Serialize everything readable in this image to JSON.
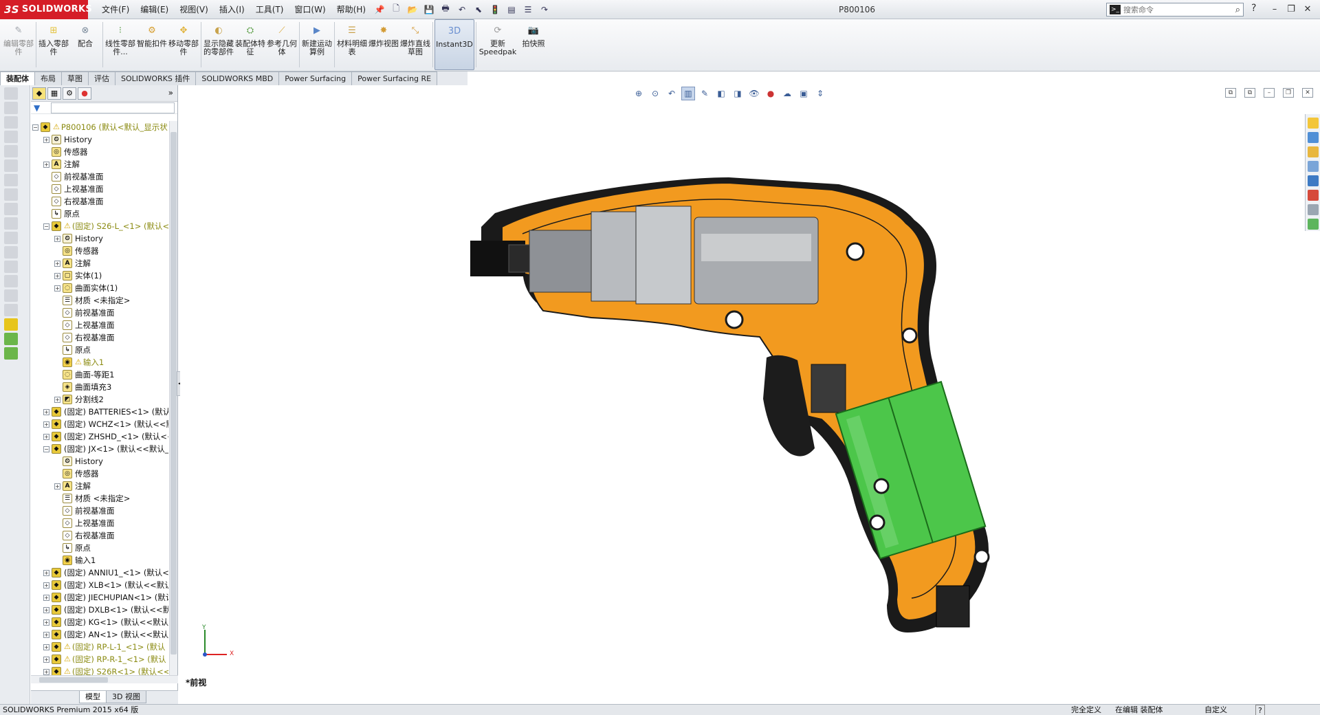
{
  "app": {
    "logo_text": "SOLIDWORKS",
    "document_title": "P800106"
  },
  "menu": [
    "文件(F)",
    "编辑(E)",
    "视图(V)",
    "插入(I)",
    "工具(T)",
    "窗口(W)",
    "帮助(H)"
  ],
  "search": {
    "placeholder": "搜索命令"
  },
  "commands": [
    {
      "label": "编辑零部件",
      "disabled": true
    },
    {
      "label": "插入零部件"
    },
    {
      "label": "配合"
    },
    {
      "label": "线性零部件..."
    },
    {
      "label": "智能扣件"
    },
    {
      "label": "移动零部件"
    },
    {
      "label": "显示隐藏的零部件"
    },
    {
      "label": "装配体特征"
    },
    {
      "label": "参考几何体"
    },
    {
      "label": "新建运动算例"
    },
    {
      "label": "材料明细表"
    },
    {
      "label": "爆炸视图"
    },
    {
      "label": "爆炸直线草图"
    },
    {
      "label": "Instant3D",
      "active": true
    },
    {
      "label": "更新Speedpak"
    },
    {
      "label": "拍快照"
    }
  ],
  "tabs": [
    "装配体",
    "布局",
    "草图",
    "评估",
    "SOLIDWORKS 插件",
    "SOLIDWORKS MBD",
    "Power Surfacing",
    "Power Surfacing RE"
  ],
  "tree": [
    {
      "level": 0,
      "label": "P800106  (默认<默认_显示状",
      "icon": "assembly",
      "warn": true,
      "exp": "-",
      "olive": true
    },
    {
      "level": 1,
      "label": "History",
      "icon": "history",
      "exp": "+"
    },
    {
      "level": 1,
      "label": "传感器",
      "icon": "sensor",
      "exp": ""
    },
    {
      "level": 1,
      "label": "注解",
      "icon": "annotation",
      "exp": "+"
    },
    {
      "level": 1,
      "label": "前视基准面",
      "icon": "plane",
      "exp": ""
    },
    {
      "level": 1,
      "label": "上视基准面",
      "icon": "plane",
      "exp": ""
    },
    {
      "level": 1,
      "label": "右视基准面",
      "icon": "plane",
      "exp": ""
    },
    {
      "level": 1,
      "label": "原点",
      "icon": "origin",
      "exp": ""
    },
    {
      "level": 1,
      "label": "(固定) S26-L_<1> (默认<",
      "icon": "part",
      "warn": true,
      "exp": "-",
      "olive": true
    },
    {
      "level": 2,
      "label": "History",
      "icon": "history",
      "exp": "+"
    },
    {
      "level": 2,
      "label": "传感器",
      "icon": "sensor",
      "exp": ""
    },
    {
      "level": 2,
      "label": "注解",
      "icon": "annotation",
      "exp": "+"
    },
    {
      "level": 2,
      "label": "实体(1)",
      "icon": "solid",
      "exp": "+"
    },
    {
      "level": 2,
      "label": "曲面实体(1)",
      "icon": "surface",
      "exp": "+"
    },
    {
      "level": 2,
      "label": "材质 <未指定>",
      "icon": "material",
      "exp": ""
    },
    {
      "level": 2,
      "label": "前视基准面",
      "icon": "plane",
      "exp": ""
    },
    {
      "level": 2,
      "label": "上视基准面",
      "icon": "plane",
      "exp": ""
    },
    {
      "level": 2,
      "label": "右视基准面",
      "icon": "plane",
      "exp": ""
    },
    {
      "level": 2,
      "label": "原点",
      "icon": "origin",
      "exp": ""
    },
    {
      "level": 2,
      "label": "输入1",
      "icon": "import",
      "warn": true,
      "exp": "",
      "olive": true
    },
    {
      "level": 2,
      "label": "曲面-等距1",
      "icon": "surface",
      "exp": ""
    },
    {
      "level": 2,
      "label": "曲面填充3",
      "icon": "fill",
      "exp": ""
    },
    {
      "level": 2,
      "label": "分割线2",
      "icon": "split",
      "exp": "+"
    },
    {
      "level": 1,
      "label": "(固定) BATTERIES<1> (默认",
      "icon": "part",
      "exp": "+"
    },
    {
      "level": 1,
      "label": "(固定) WCHZ<1> (默认<<默",
      "icon": "part",
      "exp": "+"
    },
    {
      "level": 1,
      "label": "(固定) ZHSHD_<1> (默认<<",
      "icon": "part",
      "exp": "+"
    },
    {
      "level": 1,
      "label": "(固定) JX<1> (默认<<默认_",
      "icon": "part",
      "exp": "-"
    },
    {
      "level": 2,
      "label": "History",
      "icon": "history",
      "exp": ""
    },
    {
      "level": 2,
      "label": "传感器",
      "icon": "sensor",
      "exp": ""
    },
    {
      "level": 2,
      "label": "注解",
      "icon": "annotation",
      "exp": "+"
    },
    {
      "level": 2,
      "label": "材质 <未指定>",
      "icon": "material",
      "exp": ""
    },
    {
      "level": 2,
      "label": "前视基准面",
      "icon": "plane",
      "exp": ""
    },
    {
      "level": 2,
      "label": "上视基准面",
      "icon": "plane",
      "exp": ""
    },
    {
      "level": 2,
      "label": "右视基准面",
      "icon": "plane",
      "exp": ""
    },
    {
      "level": 2,
      "label": "原点",
      "icon": "origin",
      "exp": ""
    },
    {
      "level": 2,
      "label": "输入1",
      "icon": "import",
      "exp": ""
    },
    {
      "level": 1,
      "label": "(固定) ANNIU1_<1> (默认<",
      "icon": "part",
      "exp": "+"
    },
    {
      "level": 1,
      "label": "(固定) XLB<1> (默认<<默认",
      "icon": "part",
      "exp": "+"
    },
    {
      "level": 1,
      "label": "(固定) JIECHUPIAN<1> (默认",
      "icon": "part",
      "exp": "+"
    },
    {
      "level": 1,
      "label": "(固定) DXLB<1> (默认<<默认",
      "icon": "part",
      "exp": "+"
    },
    {
      "level": 1,
      "label": "(固定) KG<1> (默认<<默认_",
      "icon": "part",
      "exp": "+"
    },
    {
      "level": 1,
      "label": "(固定) AN<1> (默认<<默认:",
      "icon": "part",
      "exp": "+"
    },
    {
      "level": 1,
      "label": "(固定) RP-L-1_<1> (默认",
      "icon": "part",
      "warn": true,
      "exp": "+",
      "olive": true
    },
    {
      "level": 1,
      "label": "(固定) RP-R-1_<1> (默认",
      "icon": "part",
      "warn": true,
      "exp": "+",
      "olive": true
    },
    {
      "level": 1,
      "label": "(固定) S26R<1> (默认<<",
      "icon": "part",
      "warn": true,
      "exp": "+",
      "olive": true
    }
  ],
  "model_tabs": [
    "模型",
    "3D 视图"
  ],
  "view_label": "*前视",
  "triad": {
    "x": "X",
    "y": "Y"
  },
  "status": {
    "product": "SOLIDWORKS Premium 2015 x64 版",
    "state": "完全定义",
    "mode": "在编辑 装配体",
    "units": "自定义"
  },
  "left_progress": 0.65,
  "colors": {
    "housing_orange": "#f29a1f",
    "housing_outline": "#1a1a1a",
    "battery_green": "#4cc64a",
    "motor_gray": "#a9acb0",
    "logo_red": "#d51d27"
  }
}
